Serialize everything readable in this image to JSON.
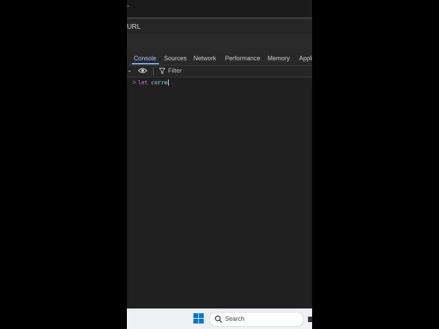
{
  "titlebar": {
    "fragment": "-"
  },
  "urlbar": {
    "fragment": "URL"
  },
  "devtools": {
    "tabs": [
      {
        "label": "Console",
        "active": true
      },
      {
        "label": "Sources",
        "active": false
      },
      {
        "label": "Network",
        "active": false
      },
      {
        "label": "Performance",
        "active": false
      },
      {
        "label": "Memory",
        "active": false
      },
      {
        "label": "Appli",
        "active": false
      }
    ],
    "toolbar": {
      "filter_placeholder": "Filter",
      "icons": [
        "chevron-down-icon",
        "eye-icon",
        "filter-icon"
      ]
    },
    "console": {
      "prompt": ">",
      "input_keyword": "let",
      "input_identifier": "corre"
    }
  },
  "taskbar": {
    "search_placeholder": "Search",
    "icons": [
      "windows-start-icon",
      "search-icon",
      "taskbar-app-icon"
    ]
  },
  "colors": {
    "panel_bg": "#202020",
    "active_tab": "#a8c7fa",
    "tab_underline": "#7cacf8",
    "keyword": "#c586c0",
    "identifier": "#9cdcfe",
    "windows_blue": "#0078d4"
  }
}
